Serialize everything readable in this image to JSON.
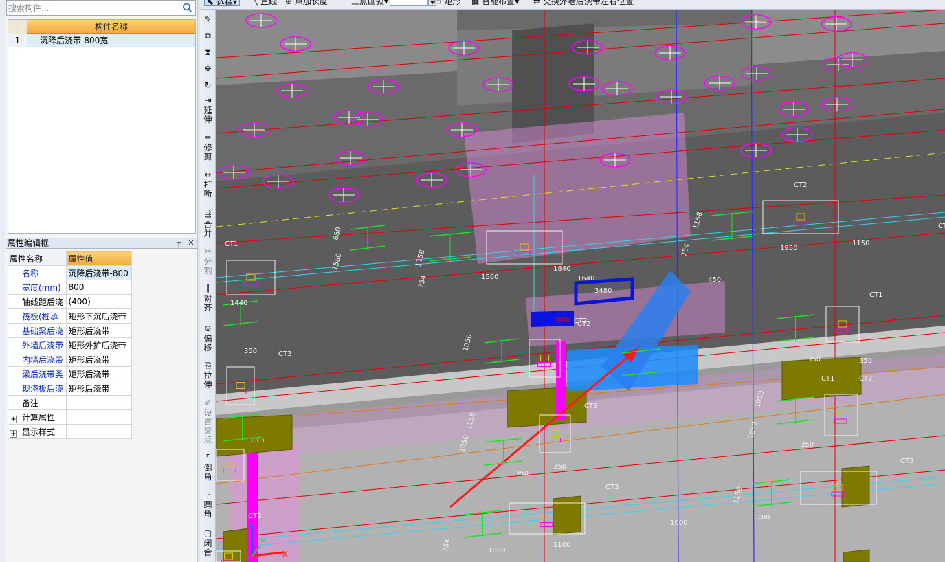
{
  "search": {
    "placeholder": "搜索构件..."
  },
  "component_list": {
    "header": "构件名称",
    "rows": [
      {
        "index": "1",
        "name": "沉降后浇带-800宽"
      }
    ]
  },
  "properties": {
    "panel_title": "属性编辑框",
    "col_name": "属性名称",
    "col_value": "属性值",
    "rows": [
      {
        "name": "名称",
        "value": "沉降后浇带-800"
      },
      {
        "name": "宽度(mm)",
        "value": "800"
      },
      {
        "name": "轴线距后浇",
        "value": "(400)"
      },
      {
        "name": "筏板(桩承",
        "value": "矩形下沉后浇带"
      },
      {
        "name": "基础梁后浇",
        "value": "矩形后浇带"
      },
      {
        "name": "外墙后浇带",
        "value": "矩形外扩后浇带"
      },
      {
        "name": "内墙后浇带",
        "value": "矩形后浇带"
      },
      {
        "name": "梁后浇带类",
        "value": "矩形后浇带"
      },
      {
        "name": "现浇板后浇",
        "value": "矩形后浇带"
      },
      {
        "name": "备注",
        "value": ""
      }
    ],
    "groups": [
      "计算属性",
      "显示样式"
    ]
  },
  "top_toolbar": {
    "items": [
      "选择",
      "直线",
      "点加长度",
      "三点画弧",
      "矩形",
      "智能布置",
      "交换外墙后浇带左右位置"
    ]
  },
  "side_toolbar": {
    "items": [
      "延伸",
      "修剪",
      "打断",
      "合并",
      "分割",
      "对齐",
      "偏移",
      "拉伸",
      "设置夹点",
      "倒角",
      "圆角",
      "闭合"
    ]
  },
  "viewport": {
    "labels": [
      "CT1",
      "CT2",
      "CT3",
      "CT1",
      "CT2",
      "CT3",
      "CT3",
      "CT2",
      "CT1",
      "CT3",
      "CT2",
      "CT2",
      "CT3",
      "CT3",
      "1560",
      "1950",
      "3480",
      "1840",
      "1000",
      "1100",
      "1000",
      "1100",
      "350",
      "350",
      "350",
      "350",
      "350",
      "350",
      "1158",
      "1158",
      "1158",
      "1158",
      "754",
      "754",
      "754",
      "1050",
      "1050",
      "1050",
      "1050",
      "1580",
      "880",
      "1440",
      "1640",
      "450",
      "1150"
    ],
    "axis_labels": [
      "Z",
      "Y",
      "X"
    ]
  }
}
